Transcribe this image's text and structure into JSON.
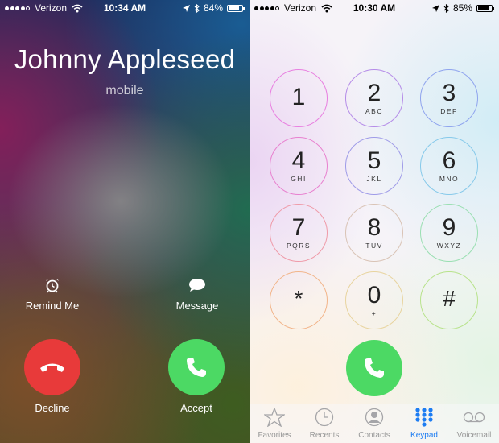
{
  "incoming_call": {
    "status_bar": {
      "carrier": "Verizon",
      "time": "10:34 AM",
      "battery": "84%",
      "battery_level": 0.84
    },
    "caller_name": "Johnny Appleseed",
    "caller_type": "mobile",
    "remind_label": "Remind Me",
    "message_label": "Message",
    "decline_label": "Decline",
    "accept_label": "Accept",
    "colors": {
      "decline": "#e83a3a",
      "accept": "#4cd964"
    }
  },
  "keypad_screen": {
    "status_bar": {
      "carrier": "Verizon",
      "time": "10:30 AM",
      "battery": "85%",
      "battery_level": 0.85
    },
    "keys": [
      {
        "digit": "1",
        "letters": ""
      },
      {
        "digit": "2",
        "letters": "ABC"
      },
      {
        "digit": "3",
        "letters": "DEF"
      },
      {
        "digit": "4",
        "letters": "GHI"
      },
      {
        "digit": "5",
        "letters": "JKL"
      },
      {
        "digit": "6",
        "letters": "MNO"
      },
      {
        "digit": "7",
        "letters": "PQRS"
      },
      {
        "digit": "8",
        "letters": "TUV"
      },
      {
        "digit": "9",
        "letters": "WXYZ"
      },
      {
        "digit": "*",
        "letters": ""
      },
      {
        "digit": "0",
        "letters": "+"
      },
      {
        "digit": "#",
        "letters": ""
      }
    ],
    "key_colors": [
      "#e87fe0",
      "#b58ce8",
      "#8fa4ee",
      "#e880cf",
      "#9f9be8",
      "#86c9ea",
      "#ef9aa8",
      "#d9c3b5",
      "#9adfb2",
      "#f2b58a",
      "#e8d49f",
      "#b8e38c"
    ],
    "tabs": [
      {
        "label": "Favorites",
        "icon": "star-icon",
        "active": false
      },
      {
        "label": "Recents",
        "icon": "clock-icon",
        "active": false
      },
      {
        "label": "Contacts",
        "icon": "contacts-icon",
        "active": false
      },
      {
        "label": "Keypad",
        "icon": "keypad-icon",
        "active": true
      },
      {
        "label": "Voicemail",
        "icon": "voicemail-icon",
        "active": false
      }
    ],
    "accent_color": "#1c7cf2"
  }
}
